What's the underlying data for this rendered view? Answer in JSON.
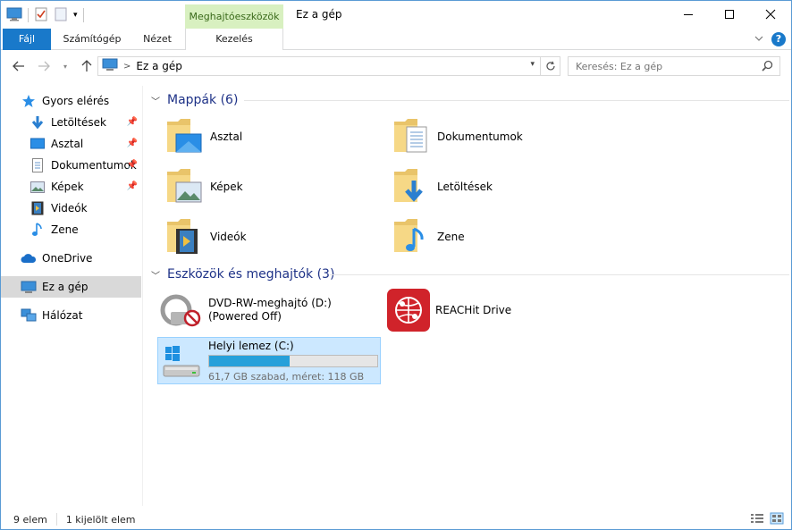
{
  "window": {
    "title": "Ez a gép",
    "context_tab_group": "Meghajtóeszközök"
  },
  "ribbon": {
    "tabs": [
      {
        "label": "Fájl"
      },
      {
        "label": "Számítógép"
      },
      {
        "label": "Nézet"
      },
      {
        "label": "Kezelés"
      }
    ]
  },
  "address": {
    "breadcrumb": "Ez a gép",
    "separator": ">",
    "search_placeholder": "Keresés: Ez a gép"
  },
  "sidebar": {
    "items": [
      {
        "label": "Gyors elérés",
        "icon": "star-icon",
        "pinned": false
      },
      {
        "label": "Letöltések",
        "icon": "download-icon",
        "pinned": true
      },
      {
        "label": "Asztal",
        "icon": "desktop-icon",
        "pinned": true
      },
      {
        "label": "Dokumentumok",
        "icon": "document-icon",
        "pinned": true
      },
      {
        "label": "Képek",
        "icon": "pictures-icon",
        "pinned": true
      },
      {
        "label": "Videók",
        "icon": "video-icon",
        "pinned": false
      },
      {
        "label": "Zene",
        "icon": "music-icon",
        "pinned": false
      },
      {
        "label": "OneDrive",
        "icon": "cloud-icon",
        "pinned": false
      },
      {
        "label": "Ez a gép",
        "icon": "computer-icon",
        "pinned": false,
        "selected": true
      },
      {
        "label": "Hálózat",
        "icon": "network-icon",
        "pinned": false
      }
    ]
  },
  "content": {
    "folders_group": "Mappák (6)",
    "folders": [
      {
        "label": "Asztal",
        "overlay": "desktop"
      },
      {
        "label": "Dokumentumok",
        "overlay": "document"
      },
      {
        "label": "Képek",
        "overlay": "pictures"
      },
      {
        "label": "Letöltések",
        "overlay": "download"
      },
      {
        "label": "Videók",
        "overlay": "video"
      },
      {
        "label": "Zene",
        "overlay": "music"
      }
    ],
    "devices_group": "Eszközök és meghajtók (3)",
    "devices": [
      {
        "label": "DVD-RW-meghajtó (D:)(Powered Off)",
        "icon": "dvd-drive-icon"
      },
      {
        "label": "REACHit Drive",
        "icon": "reachit-icon"
      },
      {
        "label": "Helyi lemez (C:)",
        "icon": "windows-drive-icon",
        "free_text": "61,7 GB szabad, méret: 118 GB",
        "used_fraction": 0.477,
        "selected": true
      }
    ]
  },
  "status": {
    "item_count": "9 elem",
    "selected_count": "1 kijelölt elem"
  },
  "colors": {
    "accent": "#1979ca",
    "heading": "#1e3287",
    "selection": "#cce8ff",
    "bar_fill": "#26a0da",
    "context_tab": "#d8f0c0"
  }
}
